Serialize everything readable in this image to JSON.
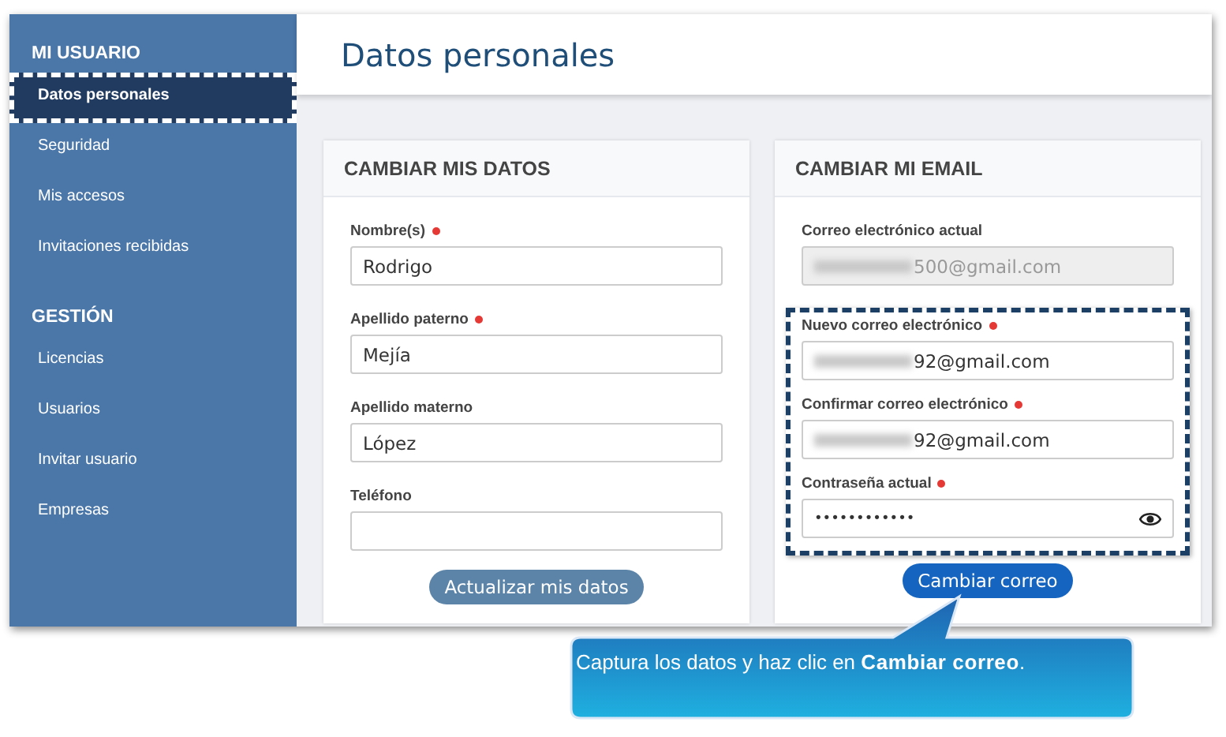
{
  "sidebar": {
    "sections": [
      {
        "title": "MI USUARIO",
        "items": [
          {
            "label": "Datos personales",
            "selected": true,
            "highlighted": true
          },
          {
            "label": "Seguridad",
            "selected": false,
            "highlighted": false
          },
          {
            "label": "Mis accesos",
            "selected": false,
            "highlighted": false
          },
          {
            "label": "Invitaciones recibidas",
            "selected": false,
            "highlighted": false
          }
        ]
      },
      {
        "title": "GESTIÓN",
        "items": [
          {
            "label": "Licencias",
            "selected": false,
            "highlighted": false
          },
          {
            "label": "Usuarios",
            "selected": false,
            "highlighted": false
          },
          {
            "label": "Invitar usuario",
            "selected": false,
            "highlighted": false
          },
          {
            "label": "Empresas",
            "selected": false,
            "highlighted": false
          }
        ]
      }
    ]
  },
  "page_title": "Datos personales",
  "cards": [
    {
      "title": "CAMBIAR MIS DATOS",
      "fields": [
        {
          "label": "Nombre(s)",
          "required": true,
          "kind": "text",
          "value": "Rodrigo",
          "disabled": false,
          "redacted": false
        },
        {
          "label": "Apellido paterno",
          "required": true,
          "kind": "text",
          "value": "Mejía",
          "disabled": false,
          "redacted": false
        },
        {
          "label": "Apellido materno",
          "required": false,
          "kind": "text",
          "value": "López",
          "disabled": false,
          "redacted": false
        },
        {
          "label": "Teléfono",
          "required": false,
          "kind": "text",
          "disabled": false,
          "redacted": false
        }
      ],
      "button": {
        "label": "Actualizar mis datos",
        "disabled": true
      }
    },
    {
      "title": "CAMBIAR MI EMAIL",
      "fields": [
        {
          "label": "Correo electrónico actual",
          "required": false,
          "kind": "text",
          "value": "500@gmail.com",
          "disabled": true,
          "redacted": true
        }
      ],
      "highlighted_fields": [
        {
          "label": "Nuevo correo electrónico",
          "required": true,
          "kind": "text",
          "value": "92@gmail.com",
          "disabled": false,
          "redacted": true
        },
        {
          "label": "Confirmar correo electrónico",
          "required": true,
          "kind": "text",
          "value": "92@gmail.com",
          "disabled": false,
          "redacted": true
        },
        {
          "label": "Contraseña actual",
          "required": true,
          "kind": "password",
          "value": "••••••••••••",
          "disabled": false,
          "redacted": false
        }
      ],
      "button": {
        "label": "Cambiar correo",
        "disabled": false
      }
    }
  ],
  "callout": {
    "text": "Captura los datos y haz clic en  **Cambiar correo**."
  }
}
